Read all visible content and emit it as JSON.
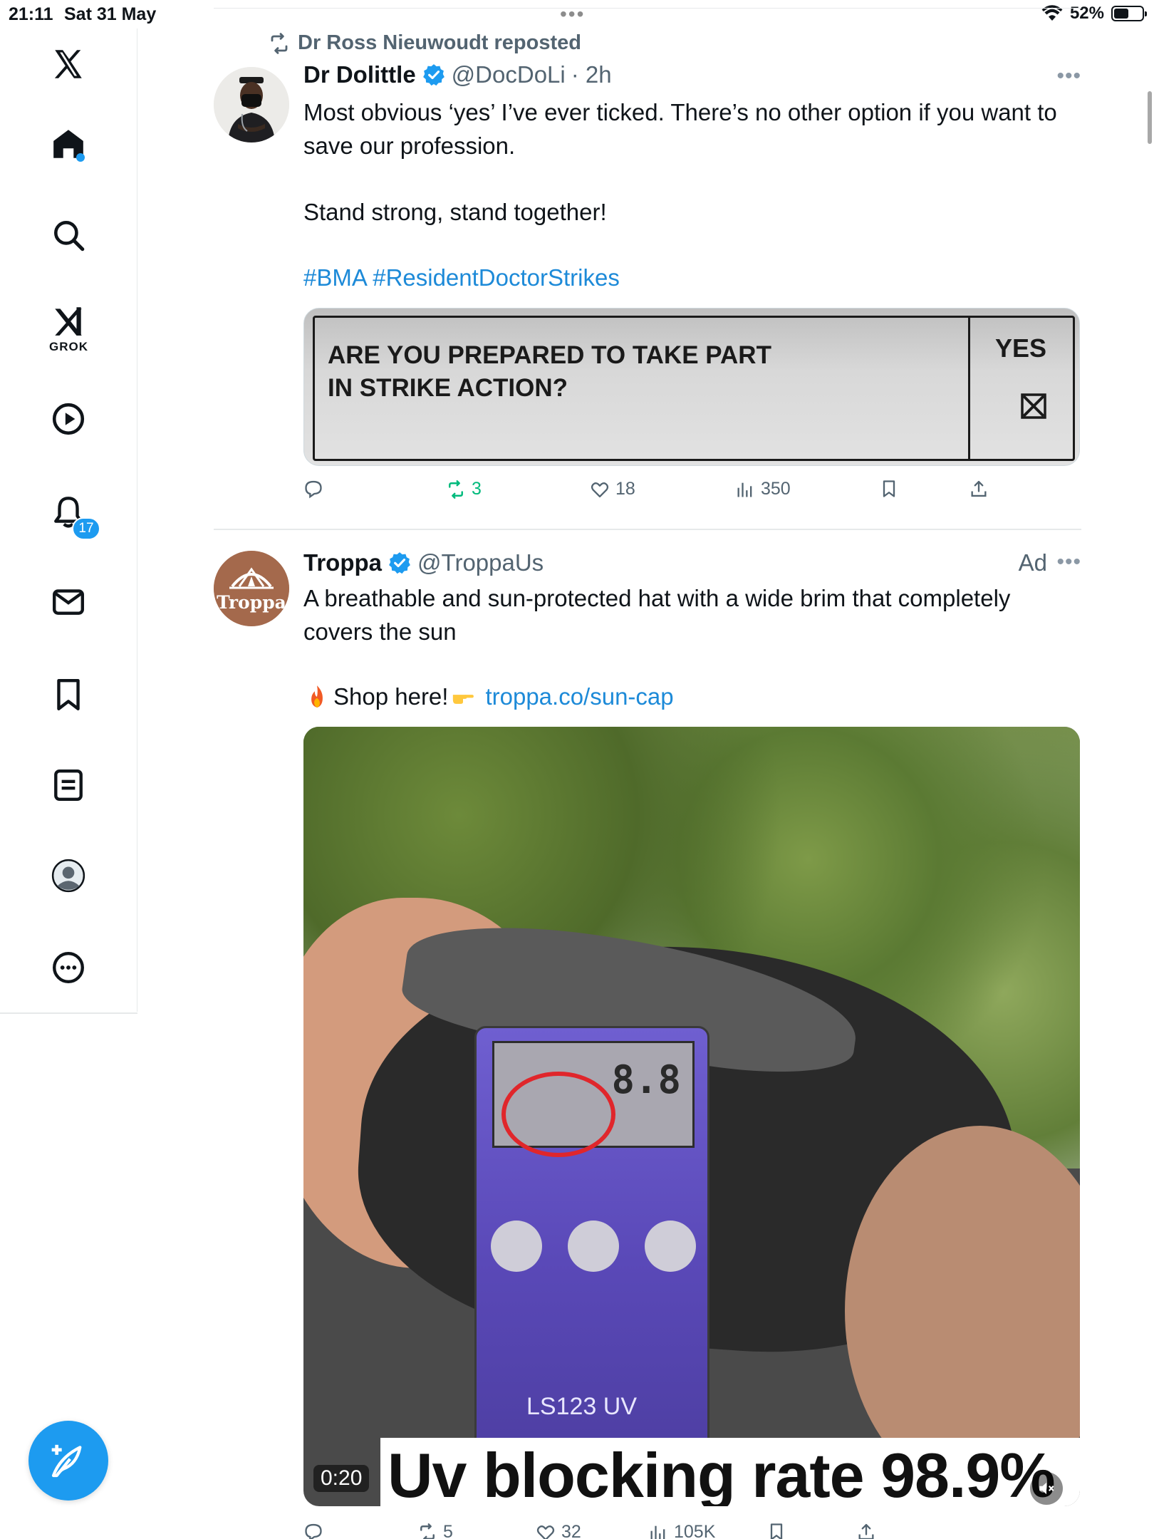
{
  "status_bar": {
    "time": "21:11",
    "date": "Sat 31 May",
    "battery": "52%",
    "battery_level": 0.52,
    "center_dots": "•••"
  },
  "sidebar": {
    "icons": [
      "x-logo-icon",
      "home-icon",
      "search-icon",
      "grok-icon",
      "video-icon",
      "notifications-icon",
      "messages-icon",
      "bookmarks-icon",
      "lists-icon",
      "profile-icon",
      "more-icon"
    ],
    "grok_label": "GROK",
    "notifications_badge": "17"
  },
  "tweet1": {
    "repost_label": "Dr Ross Nieuwoudt reposted",
    "name": "Dr Dolittle",
    "handle": "@DocDoLi",
    "time": "· 2h",
    "text_line1": "Most obvious ‘yes’ I’ve ever ticked. There’s no other option if you want to save our profession.",
    "text_line2": "Stand strong, stand together!",
    "hashtags": "#BMA #ResidentDoctorStrikes",
    "media": {
      "question_line1": "ARE YOU PREPARED TO TAKE PART",
      "question_line2": "IN STRIKE ACTION?",
      "answer": "YES"
    },
    "actions": {
      "replies": "",
      "reposts": "3",
      "likes": "18",
      "views": "350"
    }
  },
  "tweet2": {
    "name": "Troppa",
    "handle": "@TroppaUs",
    "ad_label": "Ad",
    "avatar_text": "Troppa",
    "text_line1": "A breathable and sun-protected hat with a wide brim that completely covers the sun",
    "shop_text": "Shop here!",
    "link": "troppa.co/sun-cap",
    "media": {
      "meter_digits": "8.8",
      "meter_model": "LS123 UV",
      "caption": "Uv blocking rate 98.9%",
      "duration": "0:20"
    },
    "actions": {
      "replies": "",
      "reposts": "5",
      "likes": "32",
      "views": "105K"
    }
  },
  "colors": {
    "accent": "#1d9bf0",
    "repost_green": "#00ba7c",
    "muted": "#536471"
  }
}
